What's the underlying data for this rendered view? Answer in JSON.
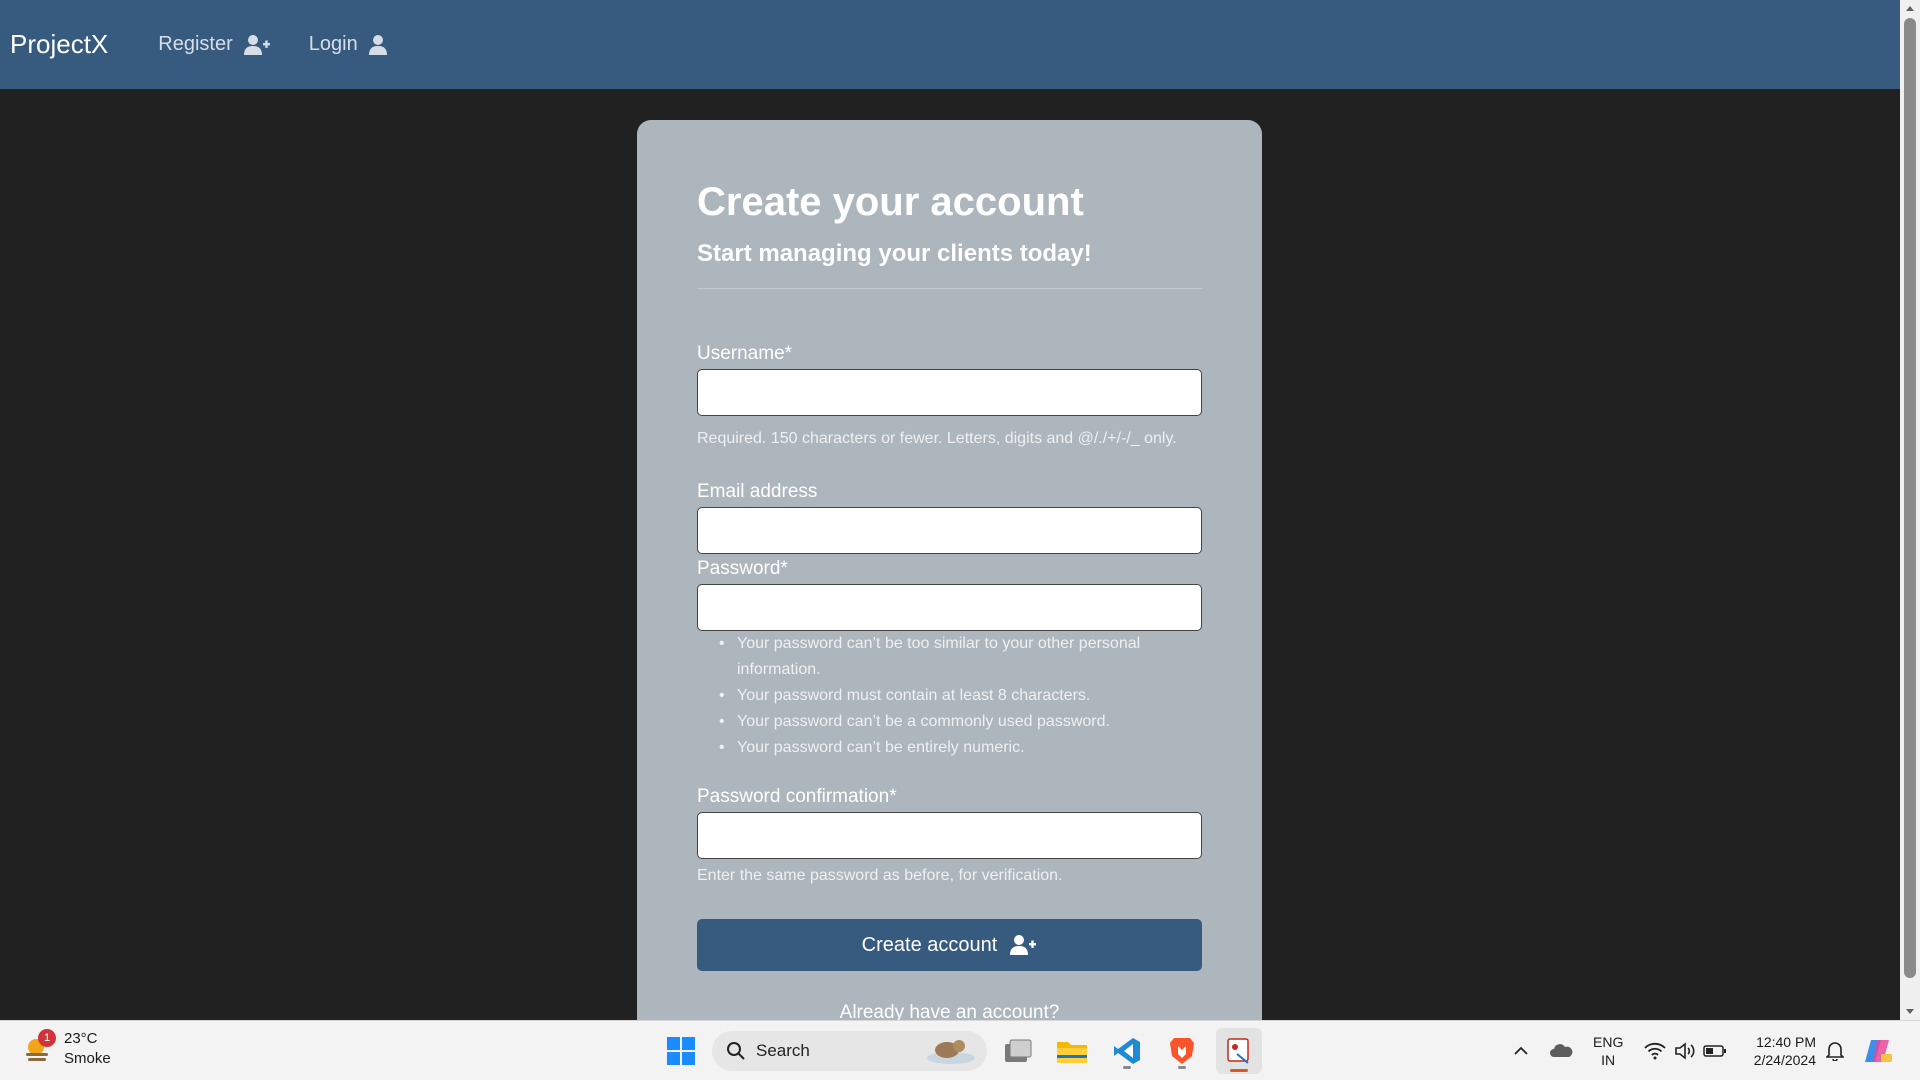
{
  "navbar": {
    "brand": "ProjectX",
    "register_label": "Register",
    "login_label": "Login"
  },
  "form": {
    "title": "Create your account",
    "subtitle": "Start managing your clients today!",
    "username_label": "Username*",
    "username_value": "",
    "username_help": "Required. 150 characters or fewer. Letters, digits and @/./+/-/_ only.",
    "email_label": "Email address",
    "email_value": "",
    "password_label": "Password*",
    "password_value": "",
    "password_rules": [
      "Your password can’t be too similar to your other personal information.",
      "Your password must contain at least 8 characters.",
      "Your password can’t be a commonly used password.",
      "Your password can’t be entirely numeric."
    ],
    "confirm_label": "Password confirmation*",
    "confirm_value": "",
    "confirm_help": "Enter the same password as before, for verification.",
    "submit_label": "Create account",
    "already_text": "Already have an account?"
  },
  "taskbar": {
    "weather_badge": "1",
    "weather_temp": "23°C",
    "weather_desc": "Smoke",
    "search_placeholder": "Search",
    "lang_top": "ENG",
    "lang_bottom": "IN",
    "time": "12:40 PM",
    "date": "2/24/2024"
  },
  "colors": {
    "navbar": "#375a7f",
    "background": "#212121",
    "card": "#adb5bd",
    "button": "#375a7f"
  },
  "icons": {
    "register": "user-plus-icon",
    "login": "user-icon",
    "submit": "user-plus-icon"
  }
}
